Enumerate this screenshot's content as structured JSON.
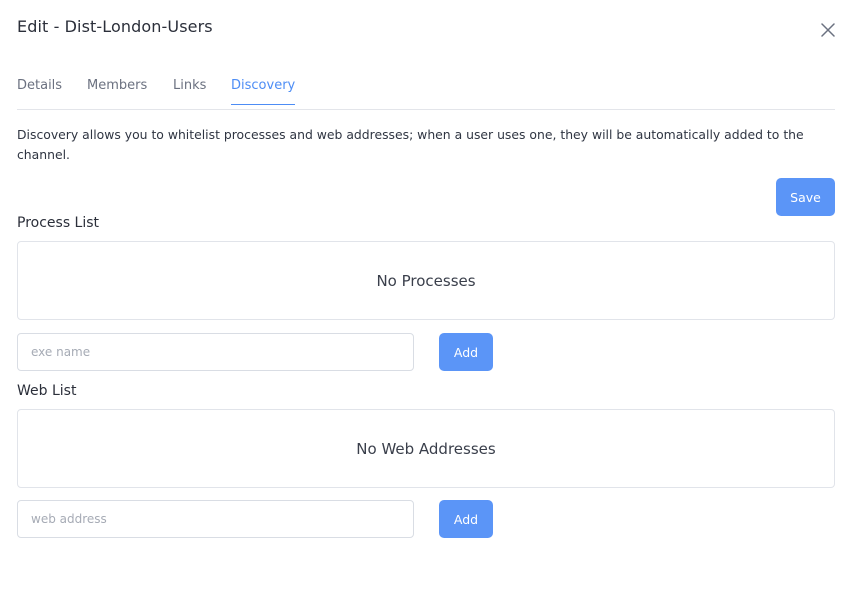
{
  "dialog": {
    "title": "Edit - Dist-London-Users"
  },
  "tabs": [
    {
      "label": "Details"
    },
    {
      "label": "Members"
    },
    {
      "label": "Links"
    },
    {
      "label": "Discovery",
      "active": true
    }
  ],
  "discovery": {
    "description": "Discovery allows you to whitelist processes and web addresses; when a user uses one, they will be automatically added to the channel.",
    "save_label": "Save",
    "process_list": {
      "title": "Process List",
      "empty_text": "No Processes",
      "input_placeholder": "exe name",
      "input_value": "",
      "add_label": "Add"
    },
    "web_list": {
      "title": "Web List",
      "empty_text": "No Web Addresses",
      "input_placeholder": "web address",
      "input_value": "",
      "add_label": "Add"
    }
  },
  "colors": {
    "accent": "#4d8df5",
    "button": "#5b95f7",
    "text": "#2f3542",
    "muted": "#6b7180",
    "border": "#e1e4ea"
  },
  "icons": {
    "close": "close-icon"
  }
}
